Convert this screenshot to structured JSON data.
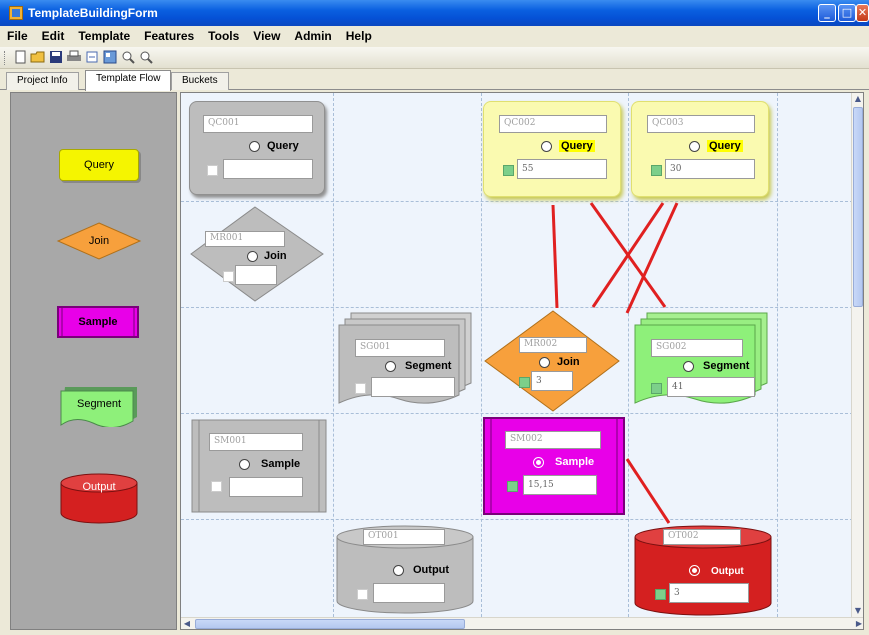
{
  "window": {
    "title": "TemplateBuildingForm"
  },
  "menu": [
    "File",
    "Edit",
    "Template",
    "Features",
    "Tools",
    "View",
    "Admin",
    "Help"
  ],
  "toolbar": [
    "new-file-icon",
    "open-folder-icon",
    "save-icon",
    "print-icon",
    "zoom-fit-icon",
    "layout-icon",
    "zoom-in-icon",
    "zoom-out-icon"
  ],
  "tabs": [
    "Project Info",
    "Template Flow",
    "Buckets"
  ],
  "active_tab": "Template Flow",
  "palette": {
    "query": "Query",
    "join": "Join",
    "sample": "Sample",
    "segment": "Segment",
    "output": "Output"
  },
  "colors": {
    "query_active": "#fafab0",
    "join_active": "#f7a03c",
    "sample_active": "#e800e8",
    "segment_active": "#8ef07a",
    "output_active": "#d42020",
    "inactive": "#bdbdbd",
    "connector": "#e02020"
  },
  "nodes": {
    "qc001": {
      "name": "QC001",
      "type": "Query",
      "value": ""
    },
    "qc002": {
      "name": "QC002",
      "type": "Query",
      "value": "55"
    },
    "qc003": {
      "name": "QC003",
      "type": "Query",
      "value": "30"
    },
    "mr001": {
      "name": "MR001",
      "type": "Join",
      "value": ""
    },
    "mr002": {
      "name": "MR002",
      "type": "Join",
      "value": "3"
    },
    "sg001": {
      "name": "SG001",
      "type": "Segment",
      "value": ""
    },
    "sg002": {
      "name": "SG002",
      "type": "Segment",
      "value": "41"
    },
    "sm001": {
      "name": "SM001",
      "type": "Sample",
      "value": ""
    },
    "sm002": {
      "name": "SM002",
      "type": "Sample",
      "value": "15,15"
    },
    "ot001": {
      "name": "OT001",
      "type": "Output",
      "value": ""
    },
    "ot002": {
      "name": "OT002",
      "type": "Output",
      "value": "3"
    }
  }
}
